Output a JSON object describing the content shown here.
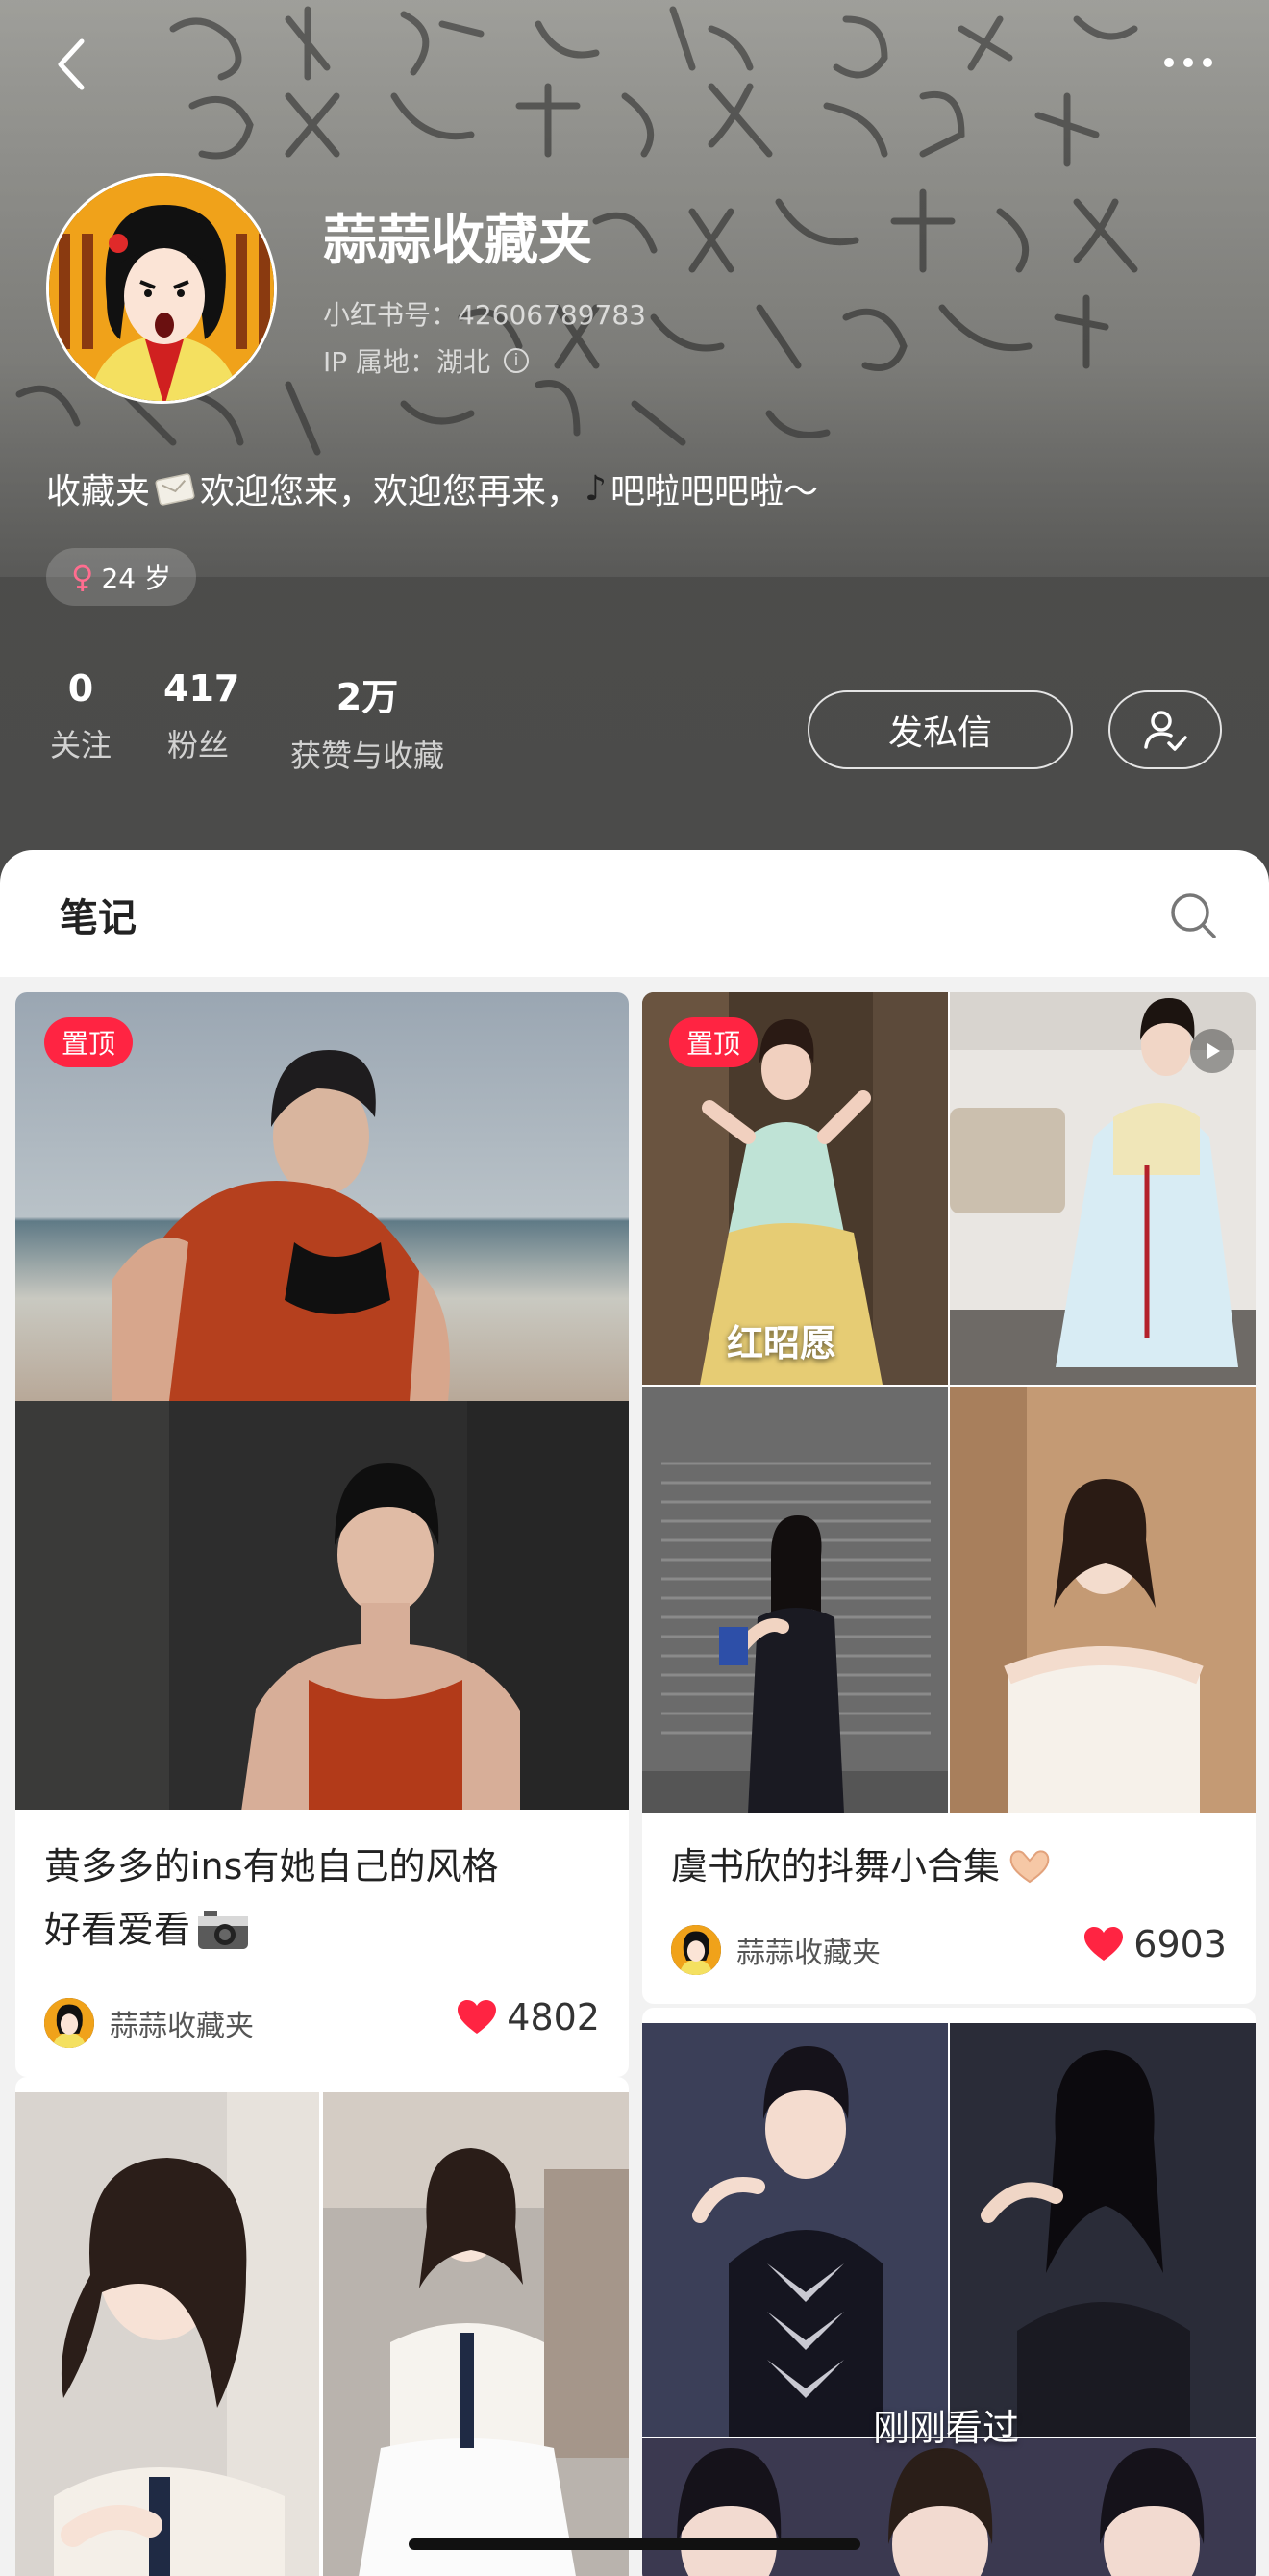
{
  "header": {
    "nickname": "蒜蒜收藏夹",
    "user_id": "小红书号：42606789783",
    "ip_location": "IP 属地：湖北",
    "bio_prefix": "收藏夹",
    "bio_middle": "欢迎您来，欢迎您再来，",
    "bio_suffix": "吧啦吧吧啦～",
    "age_tag": "24 岁",
    "background_text_lines": [
      "也会努力替你抵挡一件",
      "倒霉事，祝你接下来顺",
      "得谢谢，心想事成。记"
    ]
  },
  "stats": [
    {
      "value": "0",
      "label": "关注"
    },
    {
      "value": "417",
      "label": "粉丝"
    },
    {
      "value": "2万",
      "label": "获赞与收藏"
    }
  ],
  "actions": {
    "dm_label": "发私信"
  },
  "notes_tab": {
    "label": "笔记"
  },
  "notes": [
    {
      "pinned_label": "置顶",
      "title_line1": "黄多多的ins有她自己的风格",
      "title_line2": "好看爱看",
      "author": "蒜蒜收藏夹",
      "likes": "4802"
    },
    {
      "pinned_label": "置顶",
      "overlay_text": "红昭愿",
      "title": "虞书欣的抖舞小合集",
      "author": "蒜蒜收藏夹",
      "likes": "6903"
    },
    {
      "overlay_text": "刚刚看过"
    }
  ],
  "colors": {
    "accent": "#ff2442",
    "header_bg": "#4b4b4a",
    "female": "#ff6d8f"
  },
  "icons": [
    "back-icon",
    "more-icon",
    "info-icon",
    "female-icon",
    "follow-check-icon",
    "search-icon",
    "heart-icon",
    "play-icon",
    "camera-icon",
    "heart-hands-icon"
  ]
}
